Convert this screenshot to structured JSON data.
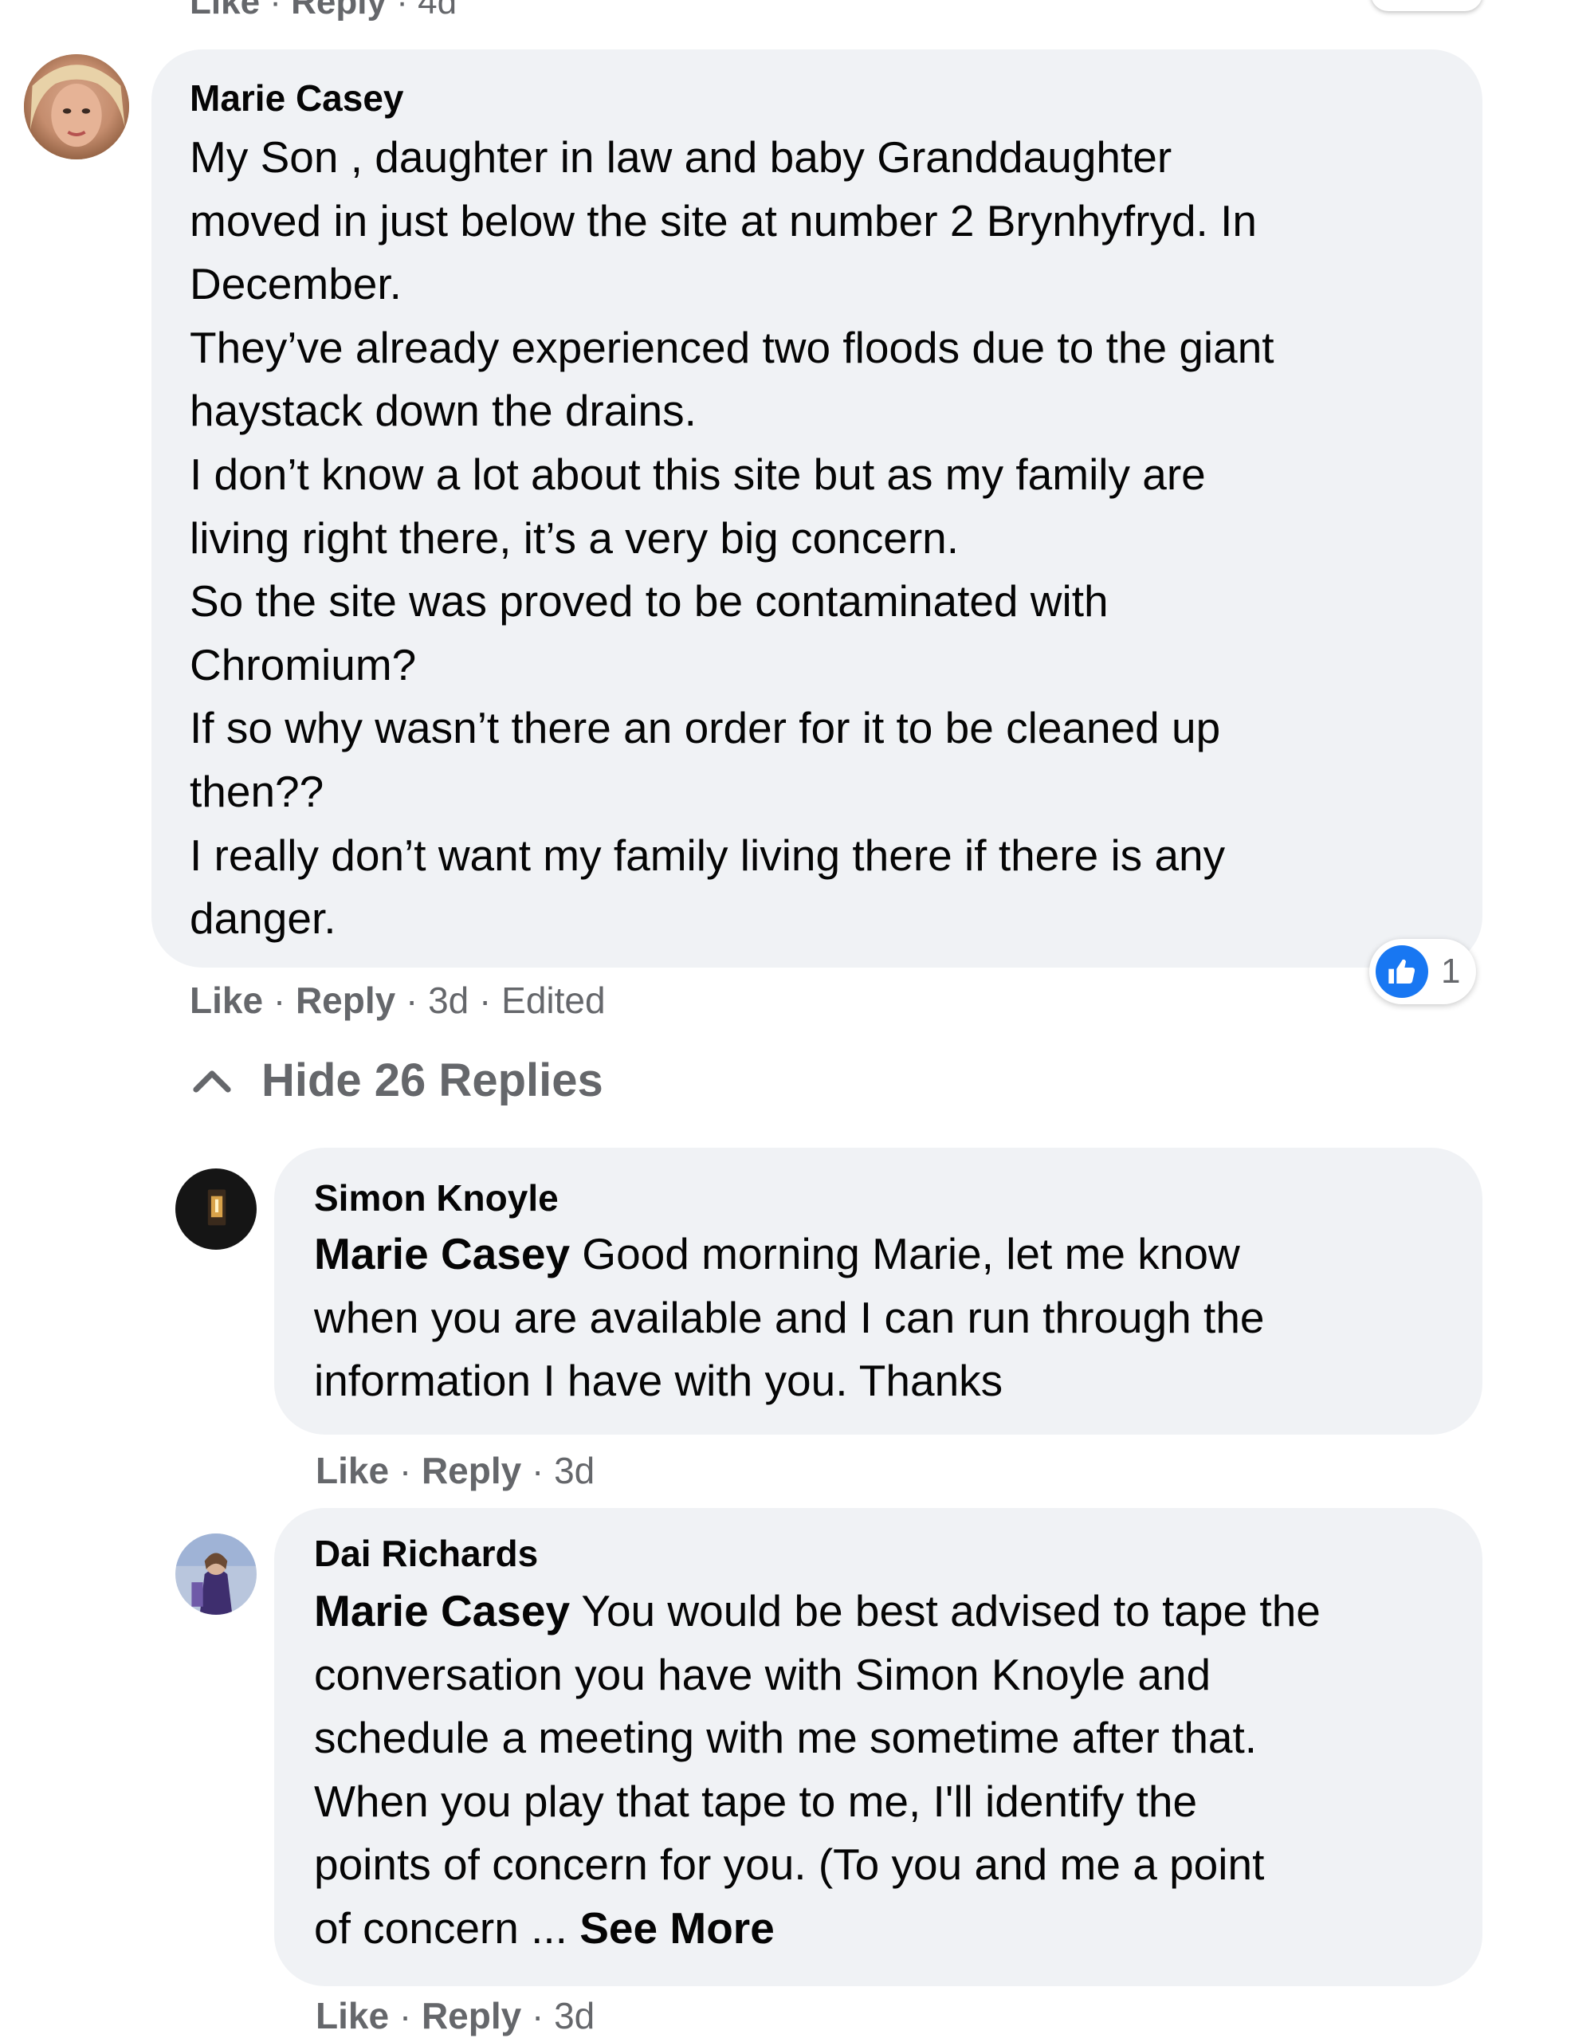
{
  "top_row": {
    "like": "Like",
    "reply": "Reply",
    "time": "4d"
  },
  "comment": {
    "author": "Marie Casey",
    "lines": [
      "My Son , daughter in law and baby Granddaughter",
      "moved in just below the site at number 2 Brynhyfryd. In",
      "December.",
      "They’ve already experienced two floods due to the giant",
      "haystack down the drains.",
      "I don’t know a lot about this site but as my family are",
      "living right there, it’s a very big concern.",
      "So the site was proved to be contaminated with",
      "Chromium?",
      "If so why wasn’t there an order for it to be cleaned up",
      "then??",
      "I really don’t want my family living there if there is any",
      "danger."
    ],
    "like": "Like",
    "reply": "Reply",
    "time": "3d",
    "edited": "Edited",
    "reaction_count": "1",
    "reaction_icon": "like-icon",
    "hide_replies": "Hide 26 Replies"
  },
  "replies": [
    {
      "author": "Simon Knoyle",
      "mention": "Marie Casey",
      "first_line_rest": " Good morning Marie, let me know",
      "lines": [
        "when you are available and I can run through the",
        "information I have with you. Thanks"
      ],
      "like": "Like",
      "reply": "Reply",
      "time": "3d"
    },
    {
      "author": "Dai Richards",
      "mention": "Marie Casey",
      "first_line_rest": " You would be best advised to tape the",
      "lines": [
        "conversation you have with Simon Knoyle and",
        "schedule a meeting with me sometime after that.",
        "When you play that tape to me, I'll identify the",
        "points of concern for you. (To you and me a point"
      ],
      "last_line": "of concern ... ",
      "see_more": "See More",
      "like": "Like",
      "reply": "Reply",
      "time": "3d"
    }
  ],
  "colors": {
    "bubble": "#f0f2f5",
    "text": "#050505",
    "secondary": "#65676b",
    "like_blue": "#1877f2"
  }
}
